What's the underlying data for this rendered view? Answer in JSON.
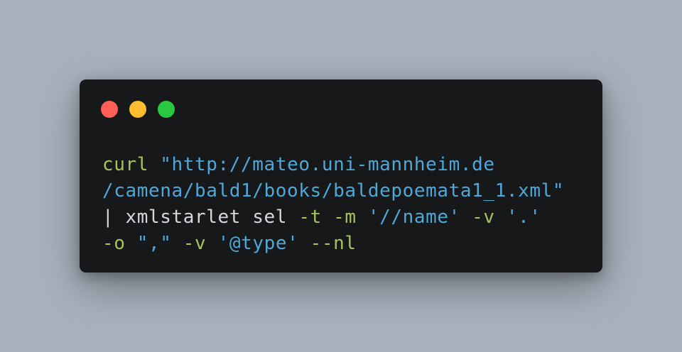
{
  "window": {
    "buttons": {
      "close_color": "#ff5f57",
      "minimize_color": "#febc2e",
      "maximize_color": "#28c840"
    }
  },
  "code": {
    "line1": {
      "cmd": "curl",
      "sp": " ",
      "str": "\"http://mateo.uni-mannheim.de"
    },
    "line2": {
      "str": "/camena/bald1/books/baldepoemata1_1.xml\""
    },
    "line3": {
      "pipe": "| xmlstarlet sel ",
      "opt_t": "-t -m ",
      "arg_m": "'//name'",
      "sp": " ",
      "opt_v": "-v ",
      "arg_v": "'.'"
    },
    "line4": {
      "opt_o": "-o ",
      "arg_o": "\",\"",
      "sp": " ",
      "opt_v": "-v ",
      "arg_v": "'@type'",
      "sp2": " ",
      "opt_nl": "--nl"
    }
  }
}
